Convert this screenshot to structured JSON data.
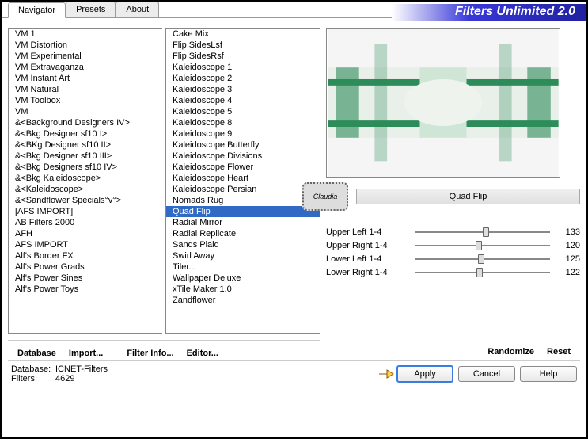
{
  "app_title": "Filters Unlimited 2.0",
  "tabs": {
    "navigator": "Navigator",
    "presets": "Presets",
    "about": "About",
    "active": "Navigator"
  },
  "left_list": {
    "items": [
      "VM 1",
      "VM Distortion",
      "VM Experimental",
      "VM Extravaganza",
      "VM Instant Art",
      "VM Natural",
      "VM Toolbox",
      "VM",
      "&<Background Designers IV>",
      "&<Bkg Designer sf10 I>",
      "&<BKg Designer sf10 II>",
      "&<Bkg Designer sf10 III>",
      "&<Bkg Designers sf10 IV>",
      "&<Bkg Kaleidoscope>",
      "&<Kaleidoscope>",
      "&<Sandflower Specials°v°>",
      "[AFS IMPORT]",
      "AB Filters 2000",
      "AFH",
      "AFS IMPORT",
      "Alf's Border FX",
      "Alf's Power Grads",
      "Alf's Power Sines",
      "Alf's Power Toys"
    ],
    "selected_index": 13
  },
  "mid_list": {
    "items": [
      "Cake Mix",
      "Flip SidesLsf",
      "Flip SidesRsf",
      "Kaleidoscope 1",
      "Kaleidoscope 2",
      "Kaleidoscope 3",
      "Kaleidoscope 4",
      "Kaleidoscope 5",
      "Kaleidoscope 8",
      "Kaleidoscope 9",
      "Kaleidoscope Butterfly",
      "Kaleidoscope Divisions",
      "Kaleidoscope Flower",
      "Kaleidoscope Heart",
      "Kaleidoscope Persian",
      "Nomads Rug",
      "Quad Flip",
      "Radial Mirror",
      "Radial Replicate",
      "Sands Plaid",
      "Swirl Away",
      "Tiler...",
      "Wallpaper Deluxe",
      "xTile Maker 1.0",
      "Zandflower"
    ],
    "selected_index": 16
  },
  "filter_name": "Quad Flip",
  "stamp_text": "Claudia",
  "sliders": [
    {
      "label": "Upper Left 1-4",
      "value": 133,
      "min": 0,
      "max": 255
    },
    {
      "label": "Upper Right 1-4",
      "value": 120,
      "min": 0,
      "max": 255
    },
    {
      "label": "Lower Left 1-4",
      "value": 125,
      "min": 0,
      "max": 255
    },
    {
      "label": "Lower Right 1-4",
      "value": 122,
      "min": 0,
      "max": 255
    }
  ],
  "bottom_links": {
    "database": "Database",
    "import": "Import...",
    "filter_info": "Filter Info...",
    "editor": "Editor...",
    "randomize": "Randomize",
    "reset": "Reset"
  },
  "footer": {
    "db_label": "Database:",
    "db_value": "ICNET-Filters",
    "filters_label": "Filters:",
    "filters_value": "4629"
  },
  "buttons": {
    "apply": "Apply",
    "cancel": "Cancel",
    "help": "Help"
  }
}
